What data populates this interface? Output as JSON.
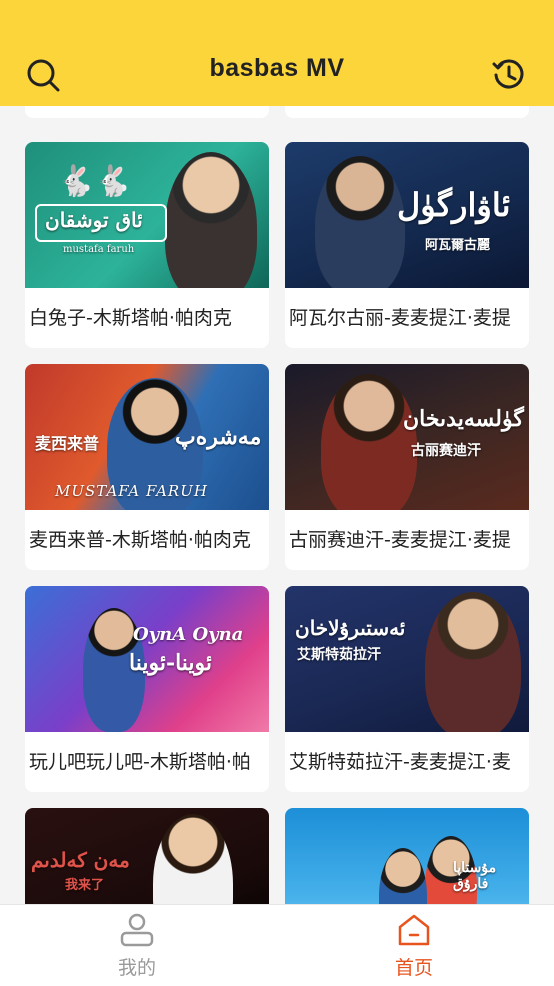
{
  "header": {
    "title": "basbas  MV"
  },
  "cards": [
    {
      "title": "白兔子-木斯塔帕·帕肉克",
      "thumb_text": "ئاق توشقان",
      "thumb_sub": "mustafa faruh"
    },
    {
      "title": "阿瓦尔古丽-麦麦提江·麦提",
      "thumb_text": "ئاۋارگۈل",
      "thumb_sub": "阿瓦爾古麗"
    },
    {
      "title": "麦西来普-木斯塔帕·帕肉克",
      "thumb_text": "مەشرەپ",
      "thumb_sub": "MUSTAFA FARUH",
      "thumb_tag": "麦西来普"
    },
    {
      "title": "古丽赛迪汗-麦麦提江·麦提",
      "thumb_text": "گۈلسەيدىخان",
      "thumb_sub": "古丽赛迪汗"
    },
    {
      "title": "玩儿吧玩儿吧-木斯塔帕·帕",
      "thumb_text": "OynA Oyna",
      "thumb_sub": "ئوينا-ئوينا"
    },
    {
      "title": "艾斯特茹拉汗-麦麦提江·麦",
      "thumb_text": "ئەستىرۇلاخان",
      "thumb_sub": "艾斯特茹拉汗"
    },
    {
      "title": "",
      "thumb_text": "مەن كەلدىم",
      "thumb_sub": "我来了"
    },
    {
      "title": "",
      "thumb_text": "مۇستاپا فارۇق",
      "thumb_sub": ""
    }
  ],
  "tabs": {
    "mine": "我的",
    "home": "首页"
  },
  "colors": {
    "header": "#fcd53a",
    "active_tab": "#e8541e",
    "inactive_tab": "#9a9a9a"
  }
}
